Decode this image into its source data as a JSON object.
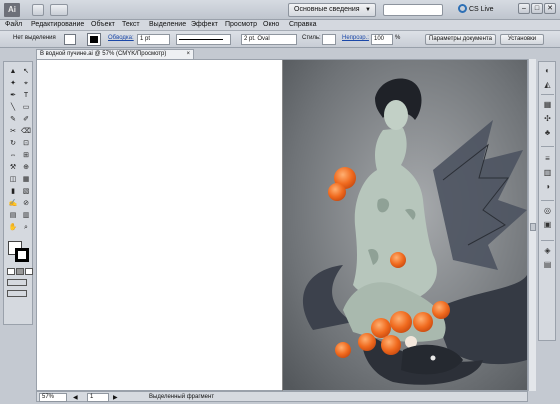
{
  "app": {
    "logo": "Ai",
    "workspace": "Основные сведения",
    "cslive": "CS Live",
    "window_buttons": [
      "–",
      "□",
      "✕"
    ]
  },
  "menu": [
    "Файл",
    "Редактирование",
    "Объект",
    "Текст",
    "Выделение",
    "Эффект",
    "Просмотр",
    "Окно",
    "Справка"
  ],
  "control": {
    "selection": "Нет выделения",
    "stroke_label": "Обводка:",
    "stroke_weight": "1 pt",
    "brush": "2 pt. Oval",
    "style_label": "Стиль:",
    "opacity_label": "Непрозр.:",
    "opacity_value": "100",
    "percent": "%",
    "doc_settings_button": "Параметры документа",
    "prefs_button": "Установки"
  },
  "document": {
    "tab_title": "В водной пучине.ai @ 57% (CMYK/Просмотр)",
    "close": "×"
  },
  "tools": {
    "glyphs": [
      "▲",
      "↖",
      "✦",
      "⌖",
      "✒",
      "T",
      "╲",
      "▭",
      "✎",
      "✐",
      "✂",
      "⌫",
      "↻",
      "⊡",
      "⇔",
      "⊞",
      "⚒",
      "⊕",
      "◫",
      "▦",
      "▮",
      "▧",
      "✍",
      "⊘",
      "▤",
      "▥",
      "✋",
      "⌕"
    ]
  },
  "status": {
    "zoom": "57%",
    "page": "1",
    "mode": "Выделенный фрагмент"
  },
  "colors": {
    "ui_bg": "#c4c9d1",
    "link": "#1b48a8",
    "artwork_bg": "#8a8d90",
    "fruit": "#f06a1e"
  }
}
